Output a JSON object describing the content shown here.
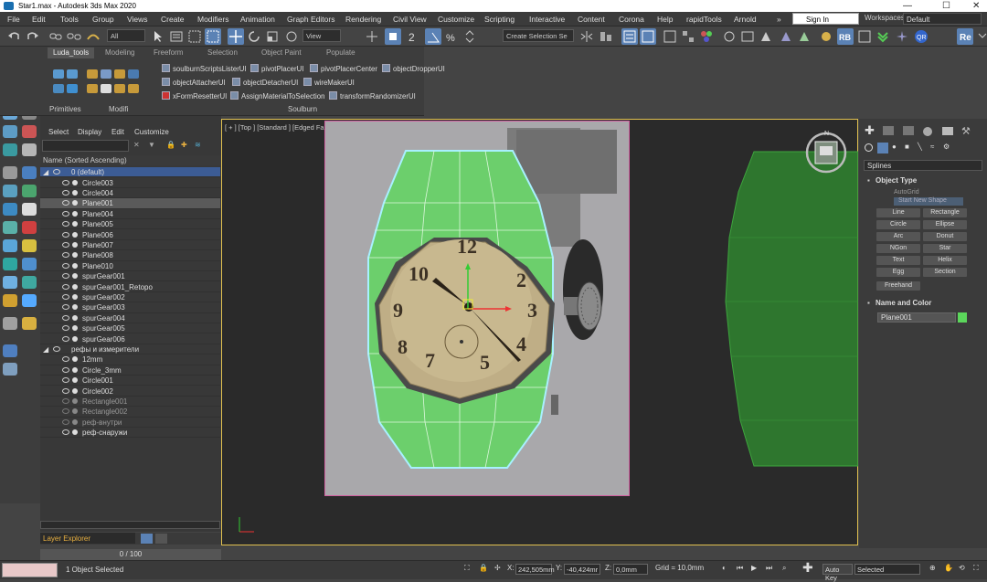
{
  "window": {
    "title": "Star1.max - Autodesk 3ds Max 2020",
    "minimize": "—",
    "maximize": "☐",
    "close": "✕"
  },
  "menu": [
    "File",
    "Edit",
    "Tools",
    "Group",
    "Views",
    "Create",
    "Modifiers",
    "Animation",
    "Graph Editors",
    "Rendering",
    "Civil View",
    "Customize",
    "Scripting",
    "Interactive",
    "Content",
    "Corona",
    "Help",
    "rapidTools",
    "Arnold",
    "»"
  ],
  "signin": "Sign In",
  "workspaces": {
    "label": "Workspaces:",
    "value": "Default"
  },
  "toolbar": {
    "filter": "All",
    "view": "View",
    "selection_set": "Create Selection Se"
  },
  "ribbon": {
    "tabs": [
      "Luda_tools",
      "Modeling",
      "Freeform",
      "Selection",
      "Object Paint",
      "Populate"
    ],
    "tools": [
      "soulburnScriptsListerUI",
      "pivotPlacerUI",
      "pivotPlacerCenter",
      "objectDropperUI",
      "objectAttacherUI",
      "objectDetacherUI",
      "wireMakerUI",
      "xFormResetterUI",
      "AssignMaterialToSelection",
      "transformRandomizerUI"
    ],
    "groups": [
      "Primitives",
      "Modifi",
      "Soulburn"
    ]
  },
  "scene": {
    "menu": [
      "Select",
      "Display",
      "Edit",
      "Customize"
    ],
    "column": "Name (Sorted Ascending)",
    "rows": [
      "0 (default)",
      "Circle003",
      "Circle004",
      "Plane001",
      "Plane004",
      "Plane005",
      "Plane006",
      "Plane007",
      "Plane008",
      "Plane010",
      "spurGear001",
      "spurGear001_Retopo",
      "spurGear002",
      "spurGear003",
      "spurGear004",
      "spurGear005",
      "spurGear006",
      "рефы и измерители",
      "12mm",
      "Circle_3mm",
      "Circle001",
      "Circle002",
      "Rectangle001",
      "Rectangle002",
      "реф-внутри",
      "реф-снаружи"
    ],
    "layer_explorer": "Layer Explorer",
    "frames": "0 / 100"
  },
  "viewport": {
    "label": "[ + ] [Top ] [Standard ] [Edged Faces ]",
    "nav_cube": "N",
    "mesh_color": "#6ccf6c",
    "edge_color": "#a8f0ff"
  },
  "photo": {
    "watch_numbers": [
      "12",
      "10",
      "2",
      "9",
      "3",
      "8",
      "4",
      "7",
      "5"
    ]
  },
  "command_panel": {
    "dropdown": "Splines",
    "object_type": "Object Type",
    "autogrid": "AutoGrid",
    "start_new_shape": "Start New Shape",
    "buttons": [
      "Line",
      "Rectangle",
      "Circle",
      "Ellipse",
      "Arc",
      "Donut",
      "NGon",
      "Star",
      "Text",
      "Helix",
      "Egg",
      "Section",
      "Freehand"
    ],
    "name_and_color": "Name and Color",
    "object_name": "Plane001",
    "object_color": "#5bd65b"
  },
  "status": {
    "selection": "1 Object Selected",
    "x_label": "X:",
    "x": "242,505mm",
    "y_label": "Y:",
    "y": "-40,424mr",
    "z_label": "Z:",
    "z": "0,0mm",
    "grid": "Grid = 10,0mm",
    "autokey": "Auto Key",
    "selected": "Selected"
  }
}
